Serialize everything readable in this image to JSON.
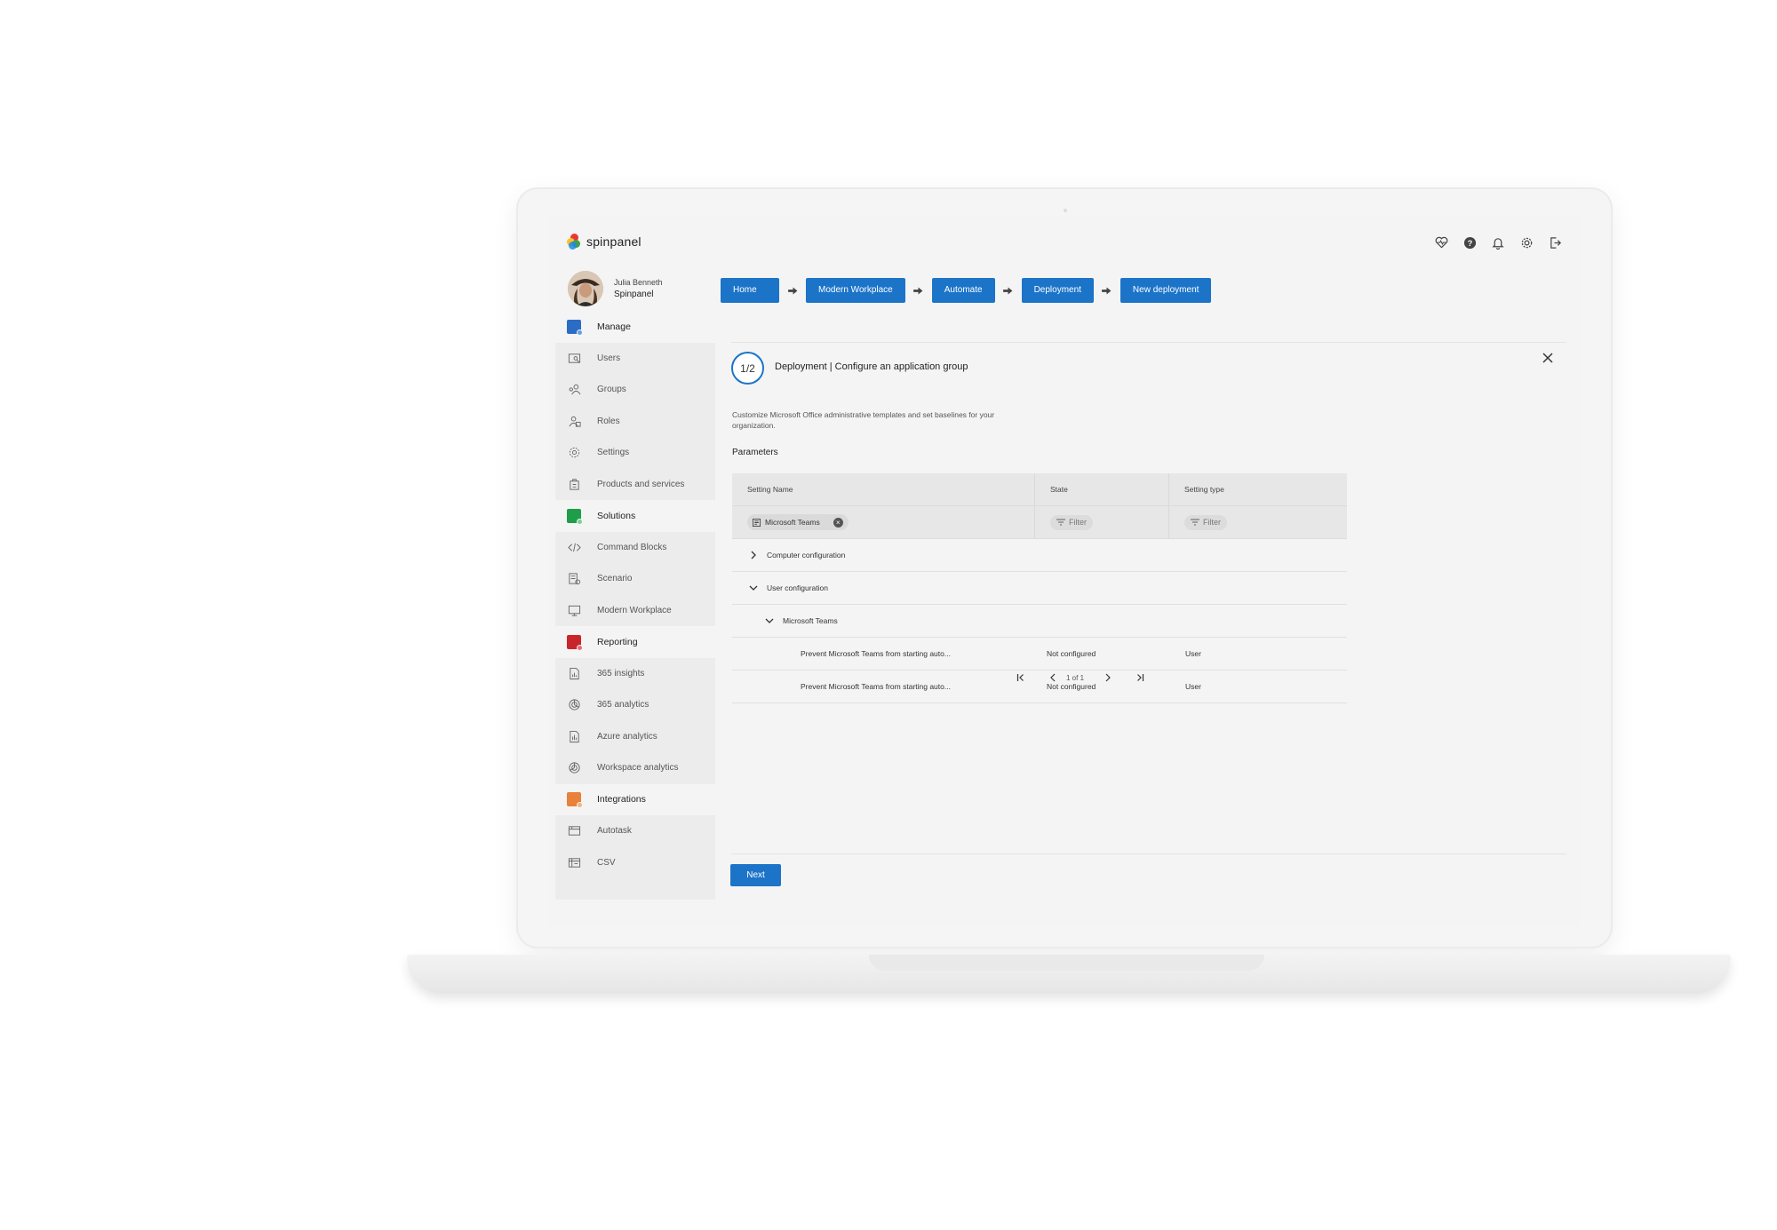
{
  "app": {
    "name": "spinpanel"
  },
  "profile": {
    "name": "Julia Benneth",
    "org": "Spinpanel"
  },
  "top_icons": [
    "heart-pulse-icon",
    "help-icon",
    "bell-icon",
    "gear-icon",
    "sign-out-icon"
  ],
  "sidebar": {
    "items": [
      {
        "label": "Manage",
        "section": true,
        "icon": "manage-icon",
        "color": "#2b6cc4"
      },
      {
        "label": "Users",
        "section": false,
        "icon": "users-icon"
      },
      {
        "label": "Groups",
        "section": false,
        "icon": "groups-icon"
      },
      {
        "label": "Roles",
        "section": false,
        "icon": "roles-icon"
      },
      {
        "label": "Settings",
        "section": false,
        "icon": "settings-icon"
      },
      {
        "label": "Products and services",
        "section": false,
        "icon": "products-icon"
      },
      {
        "label": "Solutions",
        "section": true,
        "icon": "solutions-icon",
        "color": "#1e9e4a"
      },
      {
        "label": "Command Blocks",
        "section": false,
        "icon": "command-blocks-icon"
      },
      {
        "label": "Scenario",
        "section": false,
        "icon": "scenario-icon"
      },
      {
        "label": "Modern Workplace",
        "section": false,
        "icon": "modern-workplace-icon"
      },
      {
        "label": "Reporting",
        "section": true,
        "icon": "reporting-icon",
        "color": "#c8262b"
      },
      {
        "label": "365 insights",
        "section": false,
        "icon": "insights-icon"
      },
      {
        "label": "365 analytics",
        "section": false,
        "icon": "analytics-icon"
      },
      {
        "label": "Azure analytics",
        "section": false,
        "icon": "azure-analytics-icon"
      },
      {
        "label": "Workspace analytics",
        "section": false,
        "icon": "workspace-analytics-icon"
      },
      {
        "label": "Integrations",
        "section": true,
        "icon": "integrations-icon",
        "color": "#e8813a"
      },
      {
        "label": "Autotask",
        "section": false,
        "icon": "autotask-icon"
      },
      {
        "label": "CSV",
        "section": false,
        "icon": "csv-icon"
      }
    ]
  },
  "breadcrumbs": [
    "Home",
    "Modern Workplace",
    "Automate",
    "Deployment",
    "New deployment"
  ],
  "panel": {
    "step": "1/2",
    "title": "Deployment | Configure an application group",
    "description": "Customize Microsoft Office administrative templates and set baselines for your organization.",
    "params_title": "Parameters"
  },
  "table": {
    "headers": [
      "Setting Name",
      "State",
      "Setting type"
    ],
    "filter_chip": "Microsoft Teams",
    "filter_placeholder": "Filter",
    "groups": [
      {
        "label": "Computer configuration",
        "expanded": false
      },
      {
        "label": "User configuration",
        "expanded": true
      },
      {
        "label": "Microsoft Teams",
        "expanded": true
      }
    ],
    "rows": [
      {
        "name": "Prevent Microsoft Teams from starting auto...",
        "state": "Not configured",
        "type": "User"
      },
      {
        "name": "Prevent Microsoft Teams from starting auto...",
        "state": "Not configured",
        "type": "User"
      }
    ]
  },
  "pager": {
    "text": "1 of 1"
  },
  "actions": {
    "next": "Next"
  },
  "colors": {
    "accent": "#1c74c9"
  }
}
